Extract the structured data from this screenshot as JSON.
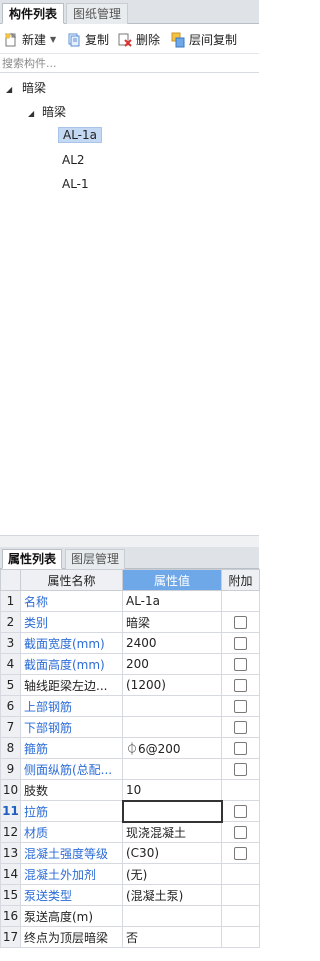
{
  "top_tabs": [
    "构件列表",
    "图纸管理"
  ],
  "toolbar": {
    "new_label": "新建",
    "copy_label": "复制",
    "delete_label": "删除",
    "floor_copy_label": "层间复制"
  },
  "search": {
    "placeholder": "搜索构件..."
  },
  "tree": {
    "root": "暗梁",
    "child": "暗梁",
    "leaves": [
      "AL-1a",
      "AL2",
      "AL-1"
    ],
    "selected": "AL-1a"
  },
  "bottom_tabs": [
    "属性列表",
    "图层管理"
  ],
  "props_table": {
    "headers": [
      "属性名称",
      "属性值",
      "附加"
    ],
    "rows": [
      {
        "no": "1",
        "name": "名称",
        "value": "AL-1a",
        "blue": true,
        "checkbox": false
      },
      {
        "no": "2",
        "name": "类别",
        "value": "暗梁",
        "blue": true,
        "checkbox": true
      },
      {
        "no": "3",
        "name": "截面宽度(mm)",
        "value": "2400",
        "blue": true,
        "checkbox": true
      },
      {
        "no": "4",
        "name": "截面高度(mm)",
        "value": "200",
        "blue": true,
        "checkbox": true
      },
      {
        "no": "5",
        "name": "轴线距梁左边...",
        "value": "(1200)",
        "blue": false,
        "checkbox": true
      },
      {
        "no": "6",
        "name": "上部钢筋",
        "value": "",
        "blue": true,
        "checkbox": true
      },
      {
        "no": "7",
        "name": "下部钢筋",
        "value": "",
        "blue": true,
        "checkbox": true
      },
      {
        "no": "8",
        "name": "箍筋",
        "value": "⏀6@200",
        "blue": true,
        "checkbox": true
      },
      {
        "no": "9",
        "name": "侧面纵筋(总配...",
        "value": "",
        "blue": true,
        "checkbox": true
      },
      {
        "no": "10",
        "name": "肢数",
        "value": "10",
        "blue": false,
        "checkbox": false
      },
      {
        "no": "11",
        "name": "拉筋",
        "value": "",
        "blue": true,
        "checkbox": true,
        "active": true
      },
      {
        "no": "12",
        "name": "材质",
        "value": "现浇混凝土",
        "blue": true,
        "checkbox": true
      },
      {
        "no": "13",
        "name": "混凝土强度等级",
        "value": "(C30)",
        "blue": true,
        "checkbox": true
      },
      {
        "no": "14",
        "name": "混凝土外加剂",
        "value": "(无)",
        "blue": true,
        "checkbox": false
      },
      {
        "no": "15",
        "name": "泵送类型",
        "value": "(混凝土泵)",
        "blue": true,
        "checkbox": false
      },
      {
        "no": "16",
        "name": "泵送高度(m)",
        "value": "",
        "blue": false,
        "checkbox": false
      },
      {
        "no": "17",
        "name": "终点为顶层暗梁",
        "value": "否",
        "blue": false,
        "checkbox": false
      }
    ]
  }
}
